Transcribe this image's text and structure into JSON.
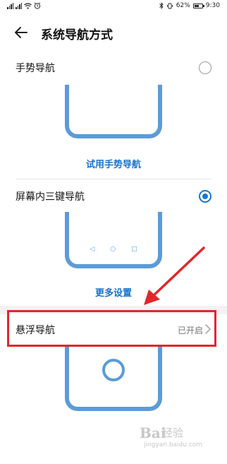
{
  "status_bar": {
    "battery_percent": "62%",
    "time": "9:30",
    "battery_level": 0.62,
    "left_icons": [
      "signal-icon",
      "signal-icon",
      "wifi-icon",
      "alarm-icon"
    ],
    "right_icons": [
      "bluetooth-icon",
      "vibrate-icon",
      "battery-icon"
    ]
  },
  "header": {
    "title": "系统导航方式"
  },
  "options": {
    "gesture": {
      "label": "手势导航",
      "selected": false,
      "try_link": "试用手势导航"
    },
    "three_key": {
      "label": "屏幕内三键导航",
      "selected": true,
      "more_link": "更多设置",
      "keys": [
        "◁",
        "○",
        "□"
      ]
    },
    "floating": {
      "label": "悬浮导航",
      "status": "已开启"
    }
  },
  "annotation": {
    "color": "#e0272c"
  },
  "watermark": {
    "logo": "Bai",
    "text": "经验",
    "url": "jingyan.baidu.com"
  },
  "colors": {
    "accent": "#1677d2",
    "phone_frame": "#5b9bd8",
    "annotation_red": "#e0272c"
  }
}
